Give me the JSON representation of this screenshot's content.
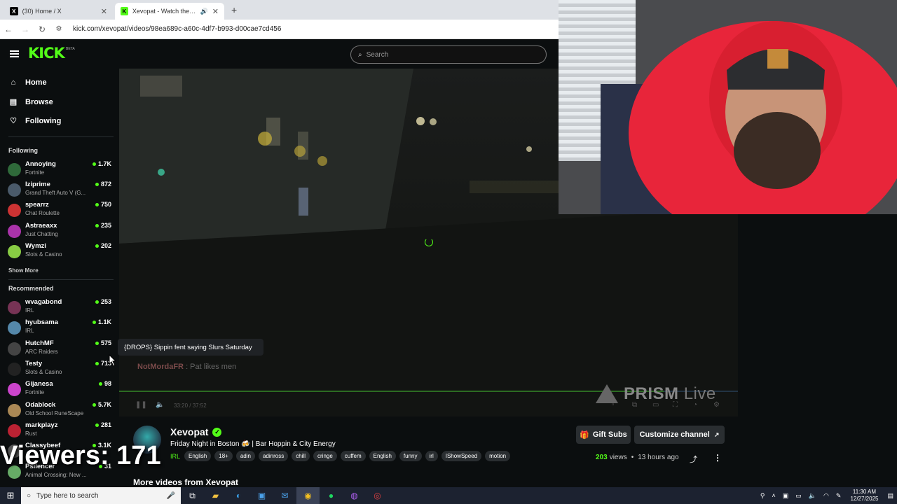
{
  "browser": {
    "tabs": [
      {
        "title": "(30) Home / X",
        "icon": "x-icon"
      },
      {
        "title": "Xevopat - Watch the VOD on Kick",
        "icon": "kick-icon"
      }
    ],
    "new_tab": "+",
    "url": "kick.com/xevopat/videos/98ea689c-a60c-4df7-b993-d00cae7cd456"
  },
  "header": {
    "logo": "KICK",
    "beta": "BETA",
    "search_placeholder": "Search"
  },
  "sidebar": {
    "nav": [
      {
        "label": "Home",
        "icon": "home-icon"
      },
      {
        "label": "Browse",
        "icon": "browse-icon"
      },
      {
        "label": "Following",
        "icon": "heart-icon"
      }
    ],
    "following_title": "Following",
    "following": [
      {
        "name": "Annoying",
        "category": "Fortnite",
        "viewers": "1.7K",
        "color": "#2f6a3a"
      },
      {
        "name": "Iziprime",
        "category": "Grand Theft Auto V (G...",
        "viewers": "872",
        "color": "#4a5a6a"
      },
      {
        "name": "spearrz",
        "category": "Chat Roulette",
        "viewers": "750",
        "color": "#c33"
      },
      {
        "name": "Astraeaxx",
        "category": "Just Chatting",
        "viewers": "235",
        "color": "#a3a"
      },
      {
        "name": "Wymzi",
        "category": "Slots & Casino",
        "viewers": "202",
        "color": "#8c4"
      }
    ],
    "show_more": "Show More",
    "recommended_title": "Recommended",
    "recommended": [
      {
        "name": "wvagabond",
        "category": "IRL",
        "viewers": "253",
        "color": "#735"
      },
      {
        "name": "hyubsama",
        "category": "IRL",
        "viewers": "1.1K",
        "color": "#58a"
      },
      {
        "name": "HutchMF",
        "category": "ARC Raiders",
        "viewers": "575",
        "color": "#444"
      },
      {
        "name": "Testy",
        "category": "Slots & Casino",
        "viewers": "713",
        "color": "#222"
      },
      {
        "name": "Gijanesa",
        "category": "Fortnite",
        "viewers": "98",
        "color": "#c4c"
      },
      {
        "name": "Odablock",
        "category": "Old School RuneScape",
        "viewers": "5.7K",
        "color": "#a85"
      },
      {
        "name": "markplayz",
        "category": "Rust",
        "viewers": "281",
        "color": "#b23"
      },
      {
        "name": "Classybeef",
        "category": "",
        "viewers": "3.1K",
        "color": "#555"
      },
      {
        "name": "Psilencer",
        "category": "Animal Crossing: New ...",
        "viewers": "31",
        "color": "#6a6"
      }
    ]
  },
  "player": {
    "chat_user": "NotMordaFR",
    "chat_text": ": Pat likes men",
    "time": "33:20 / 37:52",
    "progress": 0.88,
    "watermark": "PRISM",
    "watermark_live": "Live"
  },
  "tooltip": "{DROPS} Sippin fent saying Slurs Saturday",
  "channel": {
    "name": "Xevopat",
    "title": "Friday Night in Boston 🍻 | Bar Hoppin & City Energy",
    "category": "IRL",
    "tags": [
      "English",
      "18+",
      "adin",
      "adinross",
      "chill",
      "cringe",
      "cuffem",
      "English",
      "funny",
      "irl",
      "IShowSpeed",
      "motion"
    ],
    "gift_subs": "Gift Subs",
    "customize": "Customize channel",
    "views": "203",
    "views_label": "views",
    "ago": "13 hours ago",
    "more_videos": "More videos from Xevopat"
  },
  "overlay": {
    "viewers": "Viewers: 171"
  },
  "taskbar": {
    "search_placeholder": "Type here to search",
    "time": "11:30 AM",
    "date": "12/27/2025"
  },
  "colors": {
    "accent": "#53fc18",
    "bg": "#0b0e0f"
  }
}
